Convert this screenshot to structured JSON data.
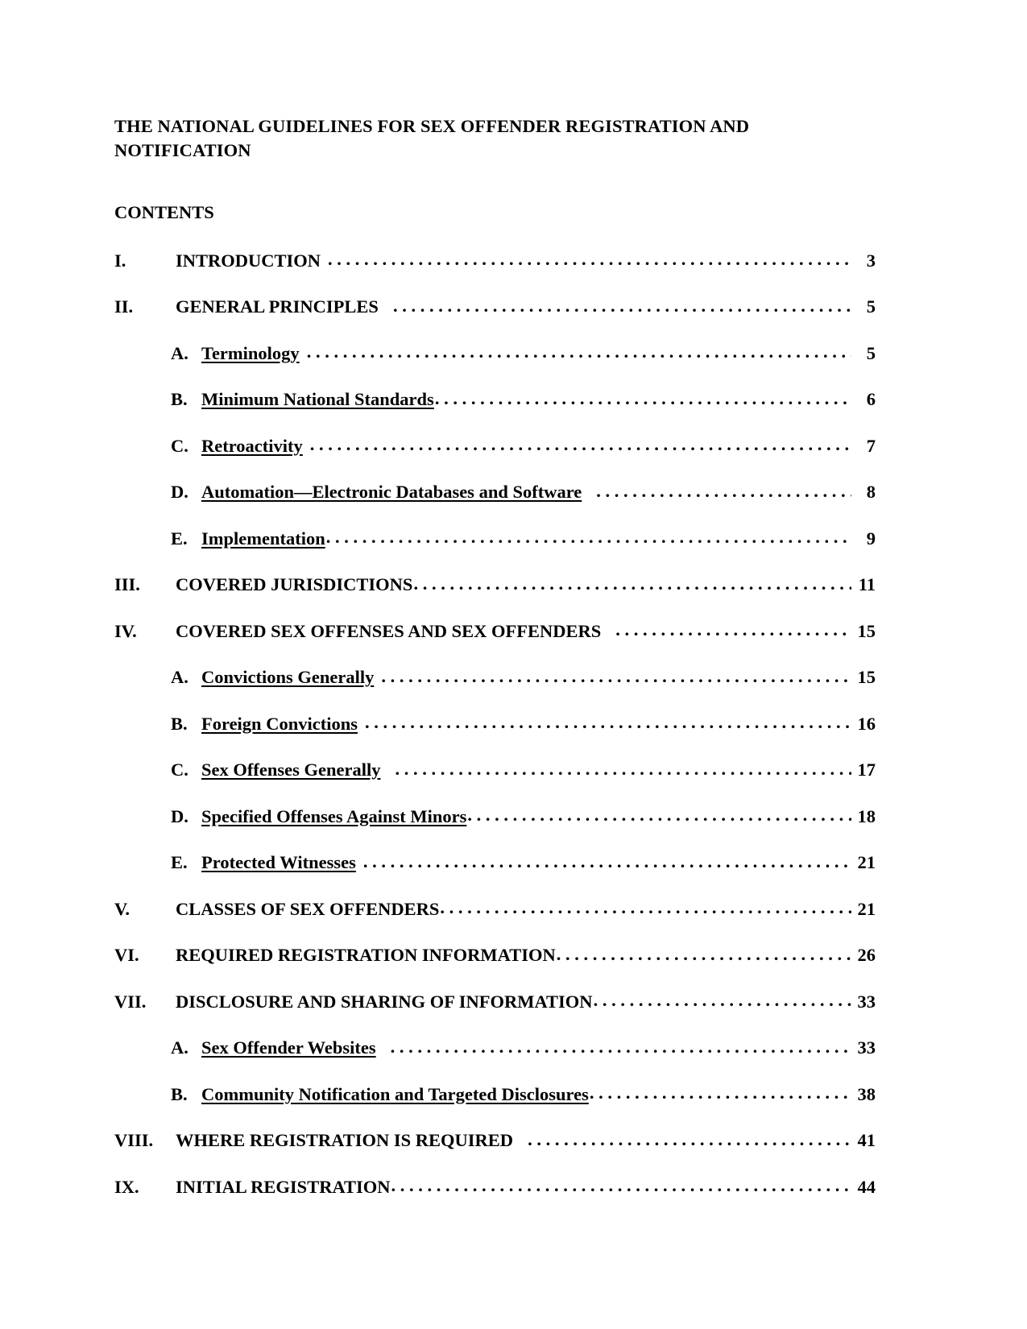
{
  "document": {
    "title": "THE NATIONAL GUIDELINES FOR SEX OFFENDER REGISTRATION AND NOTIFICATION",
    "contents_heading": "CONTENTS"
  },
  "toc": {
    "entries": [
      {
        "level": 1,
        "num": "I.",
        "label": "INTRODUCTION",
        "page": "3"
      },
      {
        "level": 1,
        "num": "II.",
        "label": "GENERAL PRINCIPLES",
        "page": "5"
      },
      {
        "level": 2,
        "num": "A.",
        "label": "Terminology",
        "page": "5"
      },
      {
        "level": 2,
        "num": "B.",
        "label": "Minimum National Standards",
        "page": "6"
      },
      {
        "level": 2,
        "num": "C.",
        "label": "Retroactivity",
        "page": "7"
      },
      {
        "level": 2,
        "num": "D.",
        "label": "Automation—Electronic Databases and Software",
        "page": "8"
      },
      {
        "level": 2,
        "num": "E.",
        "label": "Implementation",
        "page": "9"
      },
      {
        "level": 1,
        "num": "III.",
        "label": "COVERED JURISDICTIONS",
        "page": "11"
      },
      {
        "level": 1,
        "num": "IV.",
        "label": "COVERED SEX OFFENSES AND SEX OFFENDERS",
        "page": "15"
      },
      {
        "level": 2,
        "num": "A.",
        "label": "Convictions Generally",
        "page": "15"
      },
      {
        "level": 2,
        "num": "B.",
        "label": "Foreign Convictions",
        "page": "16"
      },
      {
        "level": 2,
        "num": "C.",
        "label": "Sex Offenses Generally",
        "page": "17"
      },
      {
        "level": 2,
        "num": "D.",
        "label": "Specified Offenses Against Minors",
        "page": "18"
      },
      {
        "level": 2,
        "num": "E.",
        "label": "Protected Witnesses",
        "page": "21"
      },
      {
        "level": 1,
        "num": "V.",
        "label": "CLASSES OF SEX OFFENDERS",
        "page": "21"
      },
      {
        "level": 1,
        "num": "VI.",
        "label": "REQUIRED REGISTRATION INFORMATION",
        "page": "26"
      },
      {
        "level": 1,
        "num": "VII.",
        "label": "DISCLOSURE AND SHARING OF INFORMATION",
        "page": "33"
      },
      {
        "level": 2,
        "num": "A.",
        "label": "Sex Offender Websites",
        "page": "33"
      },
      {
        "level": 2,
        "num": "B.",
        "label": "Community Notification and Targeted Disclosures",
        "page": "38"
      },
      {
        "level": 1,
        "num": "VIII.",
        "label": "WHERE REGISTRATION IS REQUIRED",
        "page": "41"
      },
      {
        "level": 1,
        "num": "IX.",
        "label": "INITIAL REGISTRATION",
        "page": "44"
      }
    ]
  }
}
